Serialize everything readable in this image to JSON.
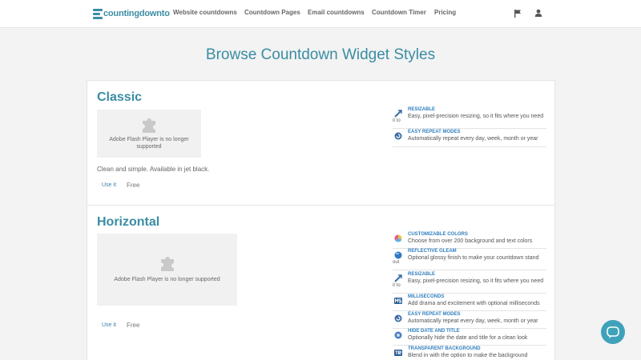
{
  "header": {
    "logo_text": "countingdownto",
    "nav": [
      "Website countdowns",
      "Countdown Pages",
      "Email countdowns",
      "Countdown Timer",
      "Pricing"
    ],
    "icons": [
      "flag-icon",
      "user-icon"
    ]
  },
  "page": {
    "title": "Browse Countdown Widget Styles"
  },
  "flash_message": "Adobe Flash Player is no longer supported",
  "styles": [
    {
      "name": "Classic",
      "description": "Clean and simple. Available in jet black.",
      "use_label": "Use it",
      "price": "Free",
      "features": [
        {
          "icon": "resize-icon",
          "side": "it to",
          "name": "RESIZABLE",
          "desc": "Easy, pixel-precision resizing, so it fits where you need"
        },
        {
          "icon": "repeat-icon",
          "side": "",
          "name": "EASY REPEAT MODES",
          "desc": "Automatically repeat every day, week, month or year"
        }
      ]
    },
    {
      "name": "Horizontal",
      "description": "",
      "use_label": "Use it",
      "price": "Free",
      "features": [
        {
          "icon": "color-wheel-icon",
          "side": "",
          "name": "CUSTOMIZABLE COLORS",
          "desc": "Choose from over 200 background and text colors"
        },
        {
          "icon": "gleam-icon",
          "side": "out",
          "name": "REFLECTIVE GLEAM",
          "desc": "Optional glossy finish to make your countdown stand"
        },
        {
          "icon": "resize-icon",
          "side": "it to",
          "name": "RESIZABLE",
          "desc": "Easy, pixel-precision resizing, so it fits where you need"
        },
        {
          "icon": "milliseconds-icon",
          "side": "",
          "name": "MILLISECONDS",
          "desc": "Add drama and excitement with optional milliseconds"
        },
        {
          "icon": "repeat-icon",
          "side": "",
          "name": "EASY REPEAT MODES",
          "desc": "Automatically repeat every day, week, month or year"
        },
        {
          "icon": "hide-icon",
          "side": "",
          "name": "HIDE DATE AND TITLE",
          "desc": "Optionally hide the date and title for a clean look"
        },
        {
          "icon": "transparent-icon",
          "side": "",
          "name": "TRANSPARENT BACKGROUND",
          "desc": "Blend in with the option to make the background"
        }
      ]
    }
  ],
  "colors": {
    "brand": "#3a8da3",
    "link": "#2f7fbf",
    "chat": "#3fa2ba"
  }
}
